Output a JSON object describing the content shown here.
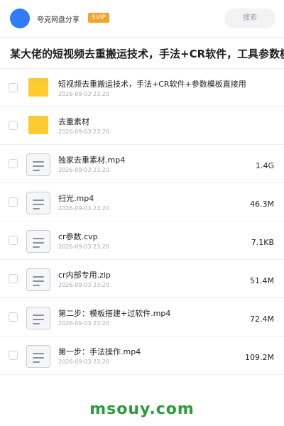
{
  "header": {
    "share_name": "夸克网盘分享",
    "badge": "SVIP",
    "search_label": "搜索"
  },
  "title": "某大佬的短视频去重搬运技术，手法+CR软件，工具参数模",
  "files": [
    {
      "type": "folder",
      "name": "短视频去重搬运技术，手法+CR软件+参数模板直接用",
      "date": "2026-09-03 23:20",
      "size": ""
    },
    {
      "type": "folder",
      "name": "去重素材",
      "date": "2026-09-03 23:20",
      "size": ""
    },
    {
      "type": "file",
      "name": "独家去重素材.mp4",
      "date": "2026-09-03 23:20",
      "size": "1.4G"
    },
    {
      "type": "file",
      "name": "扫光.mp4",
      "date": "2026-09-03 23:20",
      "size": "46.3M"
    },
    {
      "type": "file",
      "name": "cr参数.cvp",
      "date": "2026-09-03 23:20",
      "size": "7.1KB"
    },
    {
      "type": "file",
      "name": "cr内部专用.zip",
      "date": "2026-09-03 23:20",
      "size": "51.4M"
    },
    {
      "type": "file",
      "name": "第二步：模板搭建+过软件.mp4",
      "date": "2026-09-03 23:20",
      "size": "72.4M"
    },
    {
      "type": "file",
      "name": "第一步：手法操作.mp4",
      "date": "2026-09-03 23:20",
      "size": "109.2M"
    }
  ],
  "watermark": "msouy.com",
  "colors": {
    "accent": "#2e7cf6",
    "badge": "#f7a12c",
    "folder": "#ffcb2e",
    "watermark": "#2a9d3a"
  }
}
